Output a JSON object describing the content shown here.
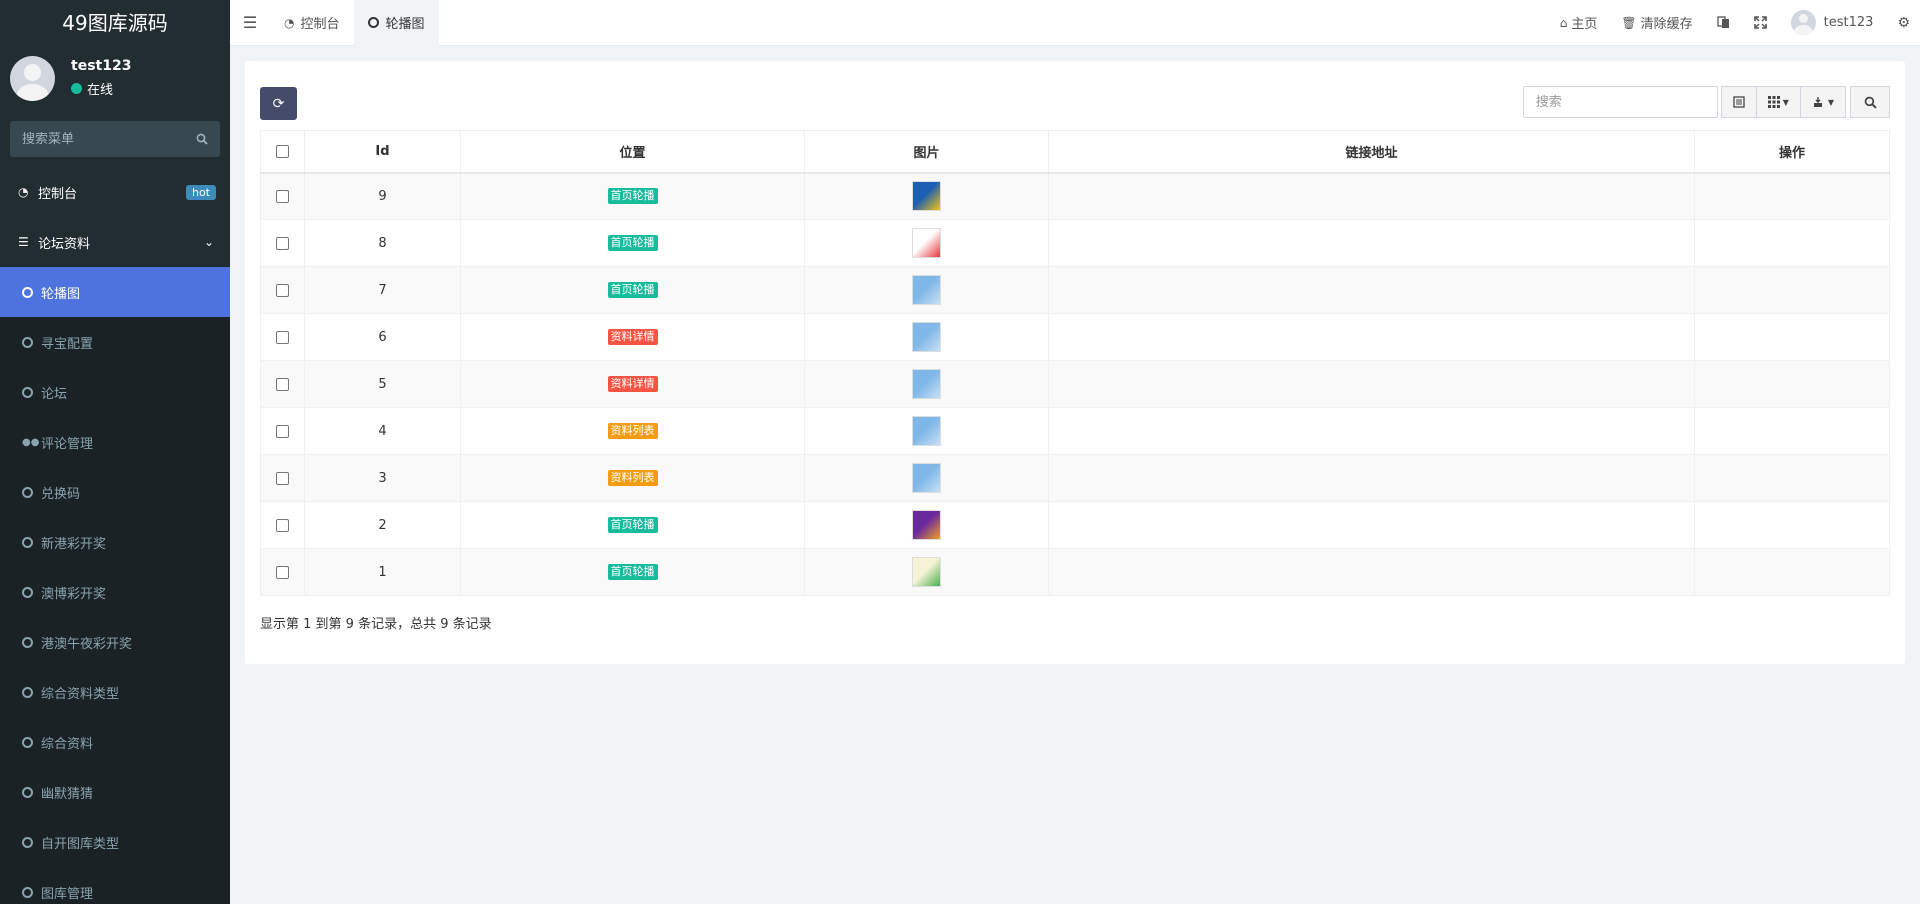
{
  "app": {
    "title": "49图库源码"
  },
  "user": {
    "name": "test123",
    "status": "在线"
  },
  "sidebar": {
    "search_placeholder": "搜索菜单",
    "dashboard": {
      "label": "控制台",
      "badge": "hot"
    },
    "group": {
      "label": "论坛资料"
    },
    "items": [
      {
        "label": "轮播图",
        "active": true
      },
      {
        "label": "寻宝配置"
      },
      {
        "label": "论坛"
      },
      {
        "label": "评论管理",
        "icon": "comments-icon"
      },
      {
        "label": "兑换码"
      },
      {
        "label": "新港彩开奖"
      },
      {
        "label": "澳博彩开奖"
      },
      {
        "label": "港澳午夜彩开奖"
      },
      {
        "label": "综合资料类型"
      },
      {
        "label": "综合资料"
      },
      {
        "label": "幽默猜猜"
      },
      {
        "label": "自开图库类型"
      },
      {
        "label": "图库管理"
      }
    ]
  },
  "header": {
    "tabs": [
      {
        "label": "控制台"
      },
      {
        "label": "轮播图"
      }
    ],
    "home": "主页",
    "clear_cache": "清除缓存",
    "username": "test123"
  },
  "toolbar": {
    "search_placeholder": "搜索"
  },
  "table": {
    "columns": [
      "Id",
      "位置",
      "图片",
      "链接地址",
      "操作"
    ],
    "rows": [
      {
        "id": "9",
        "position": "首页轮播",
        "pos_color": "#18bc9c",
        "img": [
          "#1e5fb3",
          "#f2c40f"
        ]
      },
      {
        "id": "8",
        "position": "首页轮播",
        "pos_color": "#18bc9c",
        "img": [
          "#ffffff",
          "#e8333a"
        ]
      },
      {
        "id": "7",
        "position": "首页轮播",
        "pos_color": "#18bc9c",
        "img": [
          "#7fb7e8",
          "#c8e0f5"
        ]
      },
      {
        "id": "6",
        "position": "资料详情",
        "pos_color": "#f75444",
        "img": [
          "#7fb7e8",
          "#c8e0f5"
        ]
      },
      {
        "id": "5",
        "position": "资料详情",
        "pos_color": "#f75444",
        "img": [
          "#7fb7e8",
          "#c8e0f5"
        ]
      },
      {
        "id": "4",
        "position": "资料列表",
        "pos_color": "#f39c12",
        "img": [
          "#7fb7e8",
          "#c8e0f5"
        ]
      },
      {
        "id": "3",
        "position": "资料列表",
        "pos_color": "#f39c12",
        "img": [
          "#7fb7e8",
          "#c8e0f5"
        ]
      },
      {
        "id": "2",
        "position": "首页轮播",
        "pos_color": "#18bc9c",
        "img": [
          "#6a2a9e",
          "#f0a020"
        ]
      },
      {
        "id": "1",
        "position": "首页轮播",
        "pos_color": "#18bc9c",
        "img": [
          "#f7f3d6",
          "#4caf50"
        ]
      }
    ]
  },
  "pagination": {
    "summary": "显示第 1 到第 9 条记录，总共 9 条记录"
  }
}
